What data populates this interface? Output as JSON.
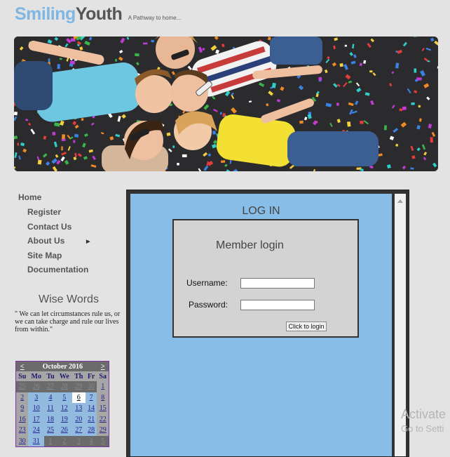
{
  "header": {
    "logo_part1": "Smiling",
    "logo_part2": "Youth",
    "tagline": "A Pathway to home..."
  },
  "nav": {
    "home": "Home",
    "items": [
      {
        "label": "Register"
      },
      {
        "label": "Contact Us"
      },
      {
        "label": "About Us"
      },
      {
        "label": "Site Map"
      },
      {
        "label": "Documentation"
      }
    ]
  },
  "wise": {
    "title": "Wise Words",
    "quote": "\" We can let circumstances rule us, or we can take charge and rule our lives from within.\""
  },
  "calendar": {
    "prev": "<",
    "next": ">",
    "month": "October 2016",
    "days": [
      "Su",
      "Mo",
      "Tu",
      "We",
      "Th",
      "Fr",
      "Sa"
    ],
    "weeks": [
      [
        "25",
        "26",
        "27",
        "28",
        "29",
        "30",
        "1"
      ],
      [
        "2",
        "3",
        "4",
        "5",
        "6",
        "7",
        "8"
      ],
      [
        "9",
        "10",
        "11",
        "12",
        "13",
        "14",
        "15"
      ],
      [
        "16",
        "17",
        "18",
        "19",
        "20",
        "21",
        "22"
      ],
      [
        "23",
        "24",
        "25",
        "26",
        "27",
        "28",
        "29"
      ],
      [
        "30",
        "31",
        "1",
        "2",
        "3",
        "4",
        "5"
      ]
    ],
    "today": "6"
  },
  "login": {
    "title": "LOG IN",
    "box_title": "Member login",
    "username_label": "Username:",
    "password_label": "Password:",
    "username_value": "",
    "password_value": "",
    "button": "Click to login"
  },
  "watermark": {
    "line1": "Activate",
    "line2": "Go to Setti"
  },
  "colors": {
    "accent": "#7fb6e2",
    "panel_bg": "#88bde8",
    "calendar_border": "#7a37a3"
  }
}
